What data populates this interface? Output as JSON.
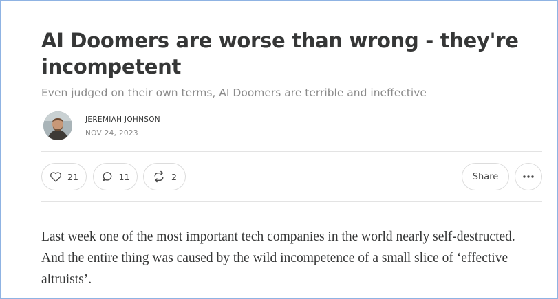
{
  "post": {
    "title": "AI Doomers are worse than wrong - they're incompetent",
    "subtitle": "Even judged on their own terms, AI Doomers are terrible and ineffective",
    "author": "JEREMIAH JOHNSON",
    "date": "NOV 24, 2023",
    "body": "Last week one of the most important tech companies in the world nearly self-destructed. And the entire thing was caused by the wild incompetence of a small slice of ‘effective altruists’."
  },
  "actions": {
    "likes": "21",
    "comments": "11",
    "restacks": "2",
    "share_label": "Share",
    "icons": {
      "like": "heart-icon",
      "comment": "comment-bubble-icon",
      "restack": "restack-arrows-icon",
      "more": "ellipsis-icon"
    }
  },
  "colors": {
    "frame_border": "#8fb3e3",
    "text": "#363737",
    "muted": "#8a8a8a",
    "divider": "#e3e3e3"
  }
}
